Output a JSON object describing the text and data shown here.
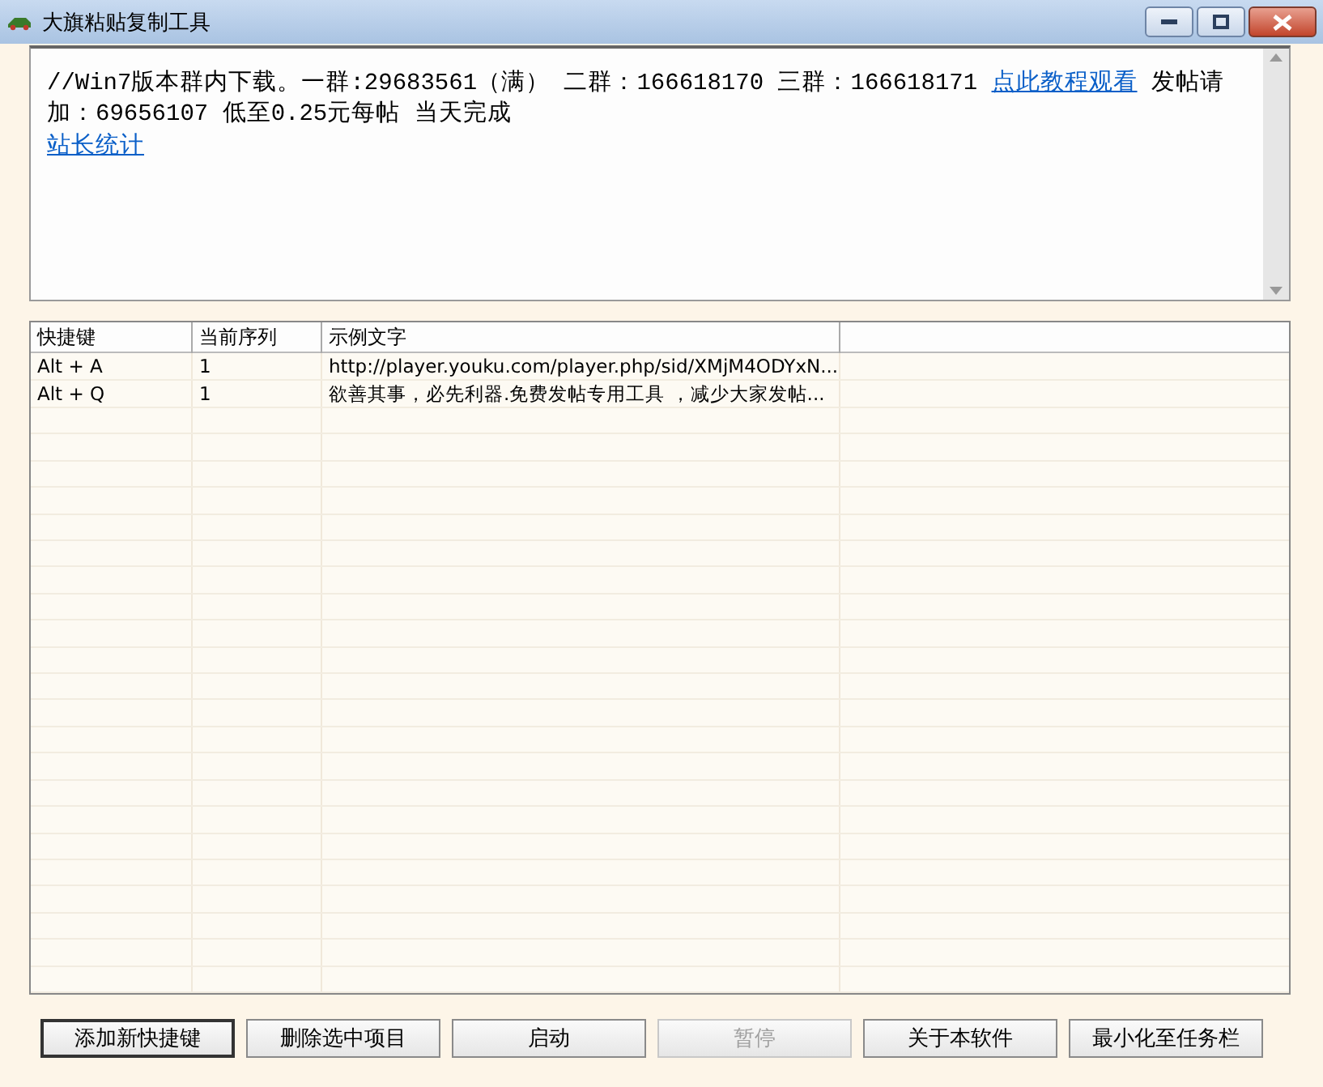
{
  "window": {
    "title": "大旗粘贴复制工具"
  },
  "notice": {
    "text_before": "//Win7版本群内下载。一群:29683561（满） 二群：166618170 三群：166618171 ",
    "link": "点此教程观看",
    "text_after": " 发帖请加：69656107 低至0.25元每帖 当天完成",
    "second_link": "站长统计"
  },
  "table": {
    "columns": [
      "快捷键",
      "当前序列",
      "示例文字"
    ],
    "rows": [
      {
        "cells": [
          "Alt + A",
          "1",
          "http://player.youku.com/player.php/sid/XMjM4ODYxN..."
        ],
        "selected": false
      },
      {
        "cells": [
          "Alt + Q",
          "1",
          "欲善其事，必先利器.免费发帖专用工具 ，减少大家发帖..."
        ],
        "selected": false
      }
    ]
  },
  "buttons": [
    {
      "label": "添加新快捷键",
      "disabled": false,
      "default": true
    },
    {
      "label": "删除选中项目",
      "disabled": false,
      "default": false
    },
    {
      "label": "启动",
      "disabled": false,
      "default": false
    },
    {
      "label": "暂停",
      "disabled": true,
      "default": false
    },
    {
      "label": "关于本软件",
      "disabled": false,
      "default": false
    },
    {
      "label": "最小化至任务栏",
      "disabled": false,
      "default": false
    }
  ]
}
